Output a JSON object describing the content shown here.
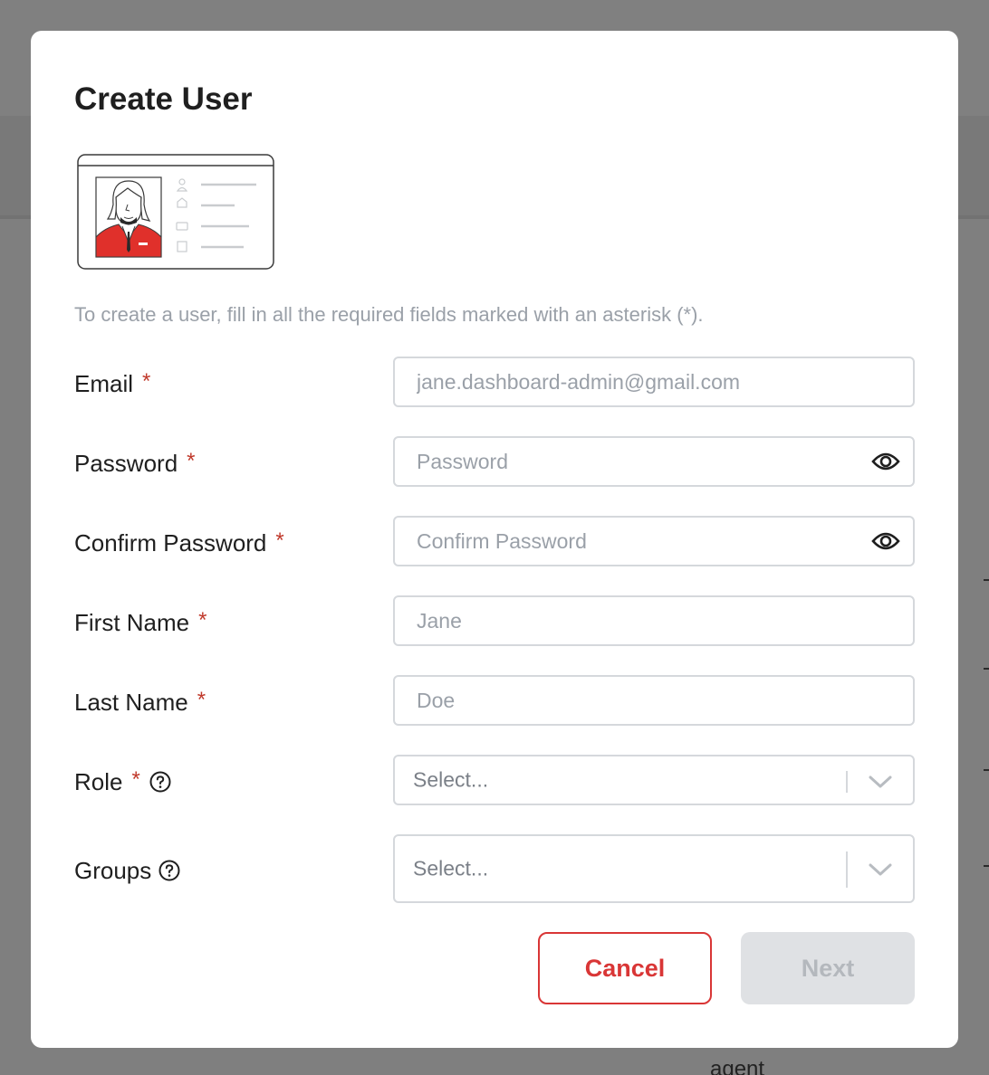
{
  "modal": {
    "title": "Create User",
    "intro": "To create a user, fill in all the required fields marked with an asterisk (*).",
    "required_marker": "*",
    "fields": {
      "email": {
        "label": "Email",
        "placeholder": "jane.dashboard-admin@gmail.com",
        "required": true
      },
      "password": {
        "label": "Password",
        "placeholder": "Password",
        "required": true,
        "icon": "eye-icon"
      },
      "confirm_password": {
        "label": "Confirm Password",
        "placeholder": "Confirm Password",
        "required": true,
        "icon": "eye-icon"
      },
      "first_name": {
        "label": "First Name",
        "placeholder": "Jane",
        "required": true
      },
      "last_name": {
        "label": "Last Name",
        "placeholder": "Doe",
        "required": true
      },
      "role": {
        "label": "Role",
        "value": "Select...",
        "required": true,
        "icon": "help-icon"
      },
      "groups": {
        "label": "Groups",
        "value": "Select...",
        "required": false,
        "icon": "help-icon"
      }
    },
    "buttons": {
      "cancel": "Cancel",
      "next": "Next"
    }
  },
  "background": {
    "partial_text": "agent"
  },
  "colors": {
    "accent": "#d93636",
    "required": "#c0392b",
    "disabled_bg": "#dfe1e4",
    "disabled_text": "#b4b8bd",
    "overlay": "#7f7f7f"
  }
}
